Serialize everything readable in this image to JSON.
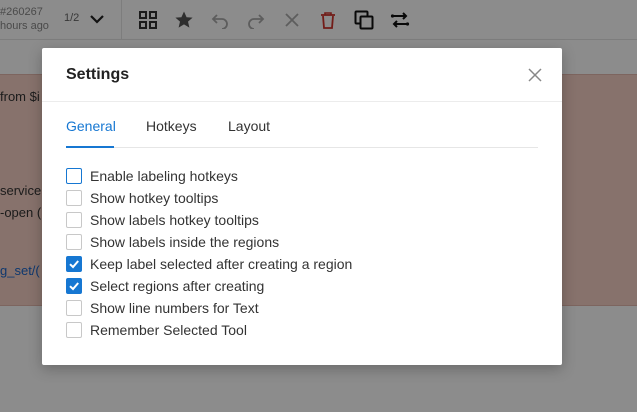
{
  "toolbar": {
    "task_id": "#260267",
    "task_time": "hours ago",
    "pager": "1/2",
    "icons": [
      "chevron-down-icon",
      "grid-icon",
      "star-icon",
      "undo-icon",
      "redo-icon",
      "close-icon",
      "delete-icon",
      "copy-icon",
      "swap-icon"
    ]
  },
  "background_text": {
    "line1": "from $i",
    "line2": "service",
    "line3": "-open (",
    "line4": "g_set/("
  },
  "colors": {
    "accent": "#1677d2",
    "delete": "#d0342c",
    "region_fill": "#f6d0c5"
  },
  "modal": {
    "title": "Settings",
    "tabs": [
      {
        "label": "General",
        "active": true
      },
      {
        "label": "Hotkeys",
        "active": false
      },
      {
        "label": "Layout",
        "active": false
      }
    ],
    "options": [
      {
        "label": "Enable labeling hotkeys",
        "checked": false,
        "focused": true
      },
      {
        "label": "Show hotkey tooltips",
        "checked": false
      },
      {
        "label": "Show labels hotkey tooltips",
        "checked": false
      },
      {
        "label": "Show labels inside the regions",
        "checked": false
      },
      {
        "label": "Keep label selected after creating a region",
        "checked": true
      },
      {
        "label": "Select regions after creating",
        "checked": true
      },
      {
        "label": "Show line numbers for Text",
        "checked": false
      },
      {
        "label": "Remember Selected Tool",
        "checked": false
      }
    ]
  }
}
